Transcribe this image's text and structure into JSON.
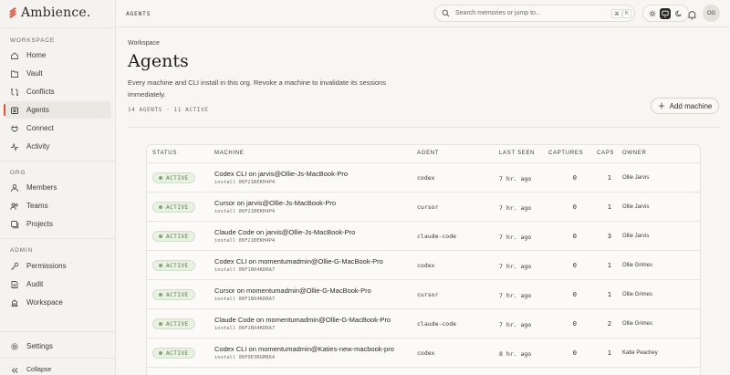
{
  "app": {
    "name": "Ambience."
  },
  "sidebar": {
    "sections": {
      "workspace": "WORKSPACE",
      "org": "ORG",
      "admin": "ADMIN"
    },
    "items": [
      {
        "label": "Home",
        "icon": "home-icon"
      },
      {
        "label": "Vault",
        "icon": "vault-icon"
      },
      {
        "label": "Conflicts",
        "icon": "conflicts-icon"
      },
      {
        "label": "Agents",
        "icon": "agents-icon",
        "active": true
      },
      {
        "label": "Connect",
        "icon": "connect-icon"
      },
      {
        "label": "Activity",
        "icon": "activity-icon"
      },
      {
        "label": "Members",
        "icon": "members-icon"
      },
      {
        "label": "Teams",
        "icon": "teams-icon"
      },
      {
        "label": "Projects",
        "icon": "projects-icon"
      },
      {
        "label": "Permissions",
        "icon": "key-icon"
      },
      {
        "label": "Audit",
        "icon": "audit-icon"
      },
      {
        "label": "Workspace",
        "icon": "workspace-icon"
      }
    ],
    "settings": "Settings",
    "collapse": "Collapse"
  },
  "topbar": {
    "breadcrumb": "AGENTS",
    "search_placeholder": "Search memories or jump to...",
    "shortcut_mod": "⌘",
    "shortcut_key": "K",
    "avatar_initials": "OG"
  },
  "page": {
    "eyebrow": "Workspace",
    "title": "Agents",
    "description": "Every machine and CLI install in this org. Revoke a machine to invalidate its sessions immediately.",
    "counts": "14 AGENTS · 11 ACTIVE",
    "add_button": "Add machine"
  },
  "table": {
    "columns": {
      "status": "STATUS",
      "machine": "MACHINE",
      "agent": "AGENT",
      "last_seen": "LAST SEEN",
      "captures": "CAPTURES",
      "caps": "CAPS",
      "owner": "OWNER"
    },
    "rows": [
      {
        "status": "ACTIVE",
        "machine": "Codex CLI on jarvis@Ollie-Js-MacBook-Pro",
        "install": "install 06F21BEKH4P4",
        "agent": "codex",
        "last_seen": "7 hr. ago",
        "captures": "0",
        "caps": "1",
        "owner": "Ollie Jarvis"
      },
      {
        "status": "ACTIVE",
        "machine": "Cursor on jarvis@Ollie-Js-MacBook-Pro",
        "install": "install 06F21BEKH4P4",
        "agent": "cursor",
        "last_seen": "7 hr. ago",
        "captures": "0",
        "caps": "1",
        "owner": "Ollie Jarvis"
      },
      {
        "status": "ACTIVE",
        "machine": "Claude Code on jarvis@Ollie-Js-MacBook-Pro",
        "install": "install 06F21BEKH4P4",
        "agent": "claude-code",
        "last_seen": "7 hr. ago",
        "captures": "0",
        "caps": "3",
        "owner": "Ollie Jarvis"
      },
      {
        "status": "ACTIVE",
        "machine": "Codex CLI on momentumadmin@Ollie-G-MacBook-Pro",
        "install": "install 06F1NX4KDRA7",
        "agent": "codex",
        "last_seen": "7 hr. ago",
        "captures": "0",
        "caps": "1",
        "owner": "Ollie Grimes"
      },
      {
        "status": "ACTIVE",
        "machine": "Cursor on momentumadmin@Ollie-G-MacBook-Pro",
        "install": "install 06F1NX4KDRA7",
        "agent": "cursor",
        "last_seen": "7 hr. ago",
        "captures": "0",
        "caps": "1",
        "owner": "Ollie Grimes"
      },
      {
        "status": "ACTIVE",
        "machine": "Claude Code on momentumadmin@Ollie-G-MacBook-Pro",
        "install": "install 06F1NX4KDRA7",
        "agent": "claude-code",
        "last_seen": "7 hr. ago",
        "captures": "0",
        "caps": "2",
        "owner": "Ollie Grimes"
      },
      {
        "status": "ACTIVE",
        "machine": "Codex CLI on momentumadmin@Katies-new-macbook-pro",
        "install": "install 06F0E3RGM864",
        "agent": "codex",
        "last_seen": "8 hr. ago",
        "captures": "0",
        "caps": "1",
        "owner": "Katie Peachey"
      }
    ]
  },
  "colors": {
    "accent": "#e0533a",
    "active_badge_bg": "#e9f1e4",
    "active_badge_text": "#5a7a4a"
  }
}
